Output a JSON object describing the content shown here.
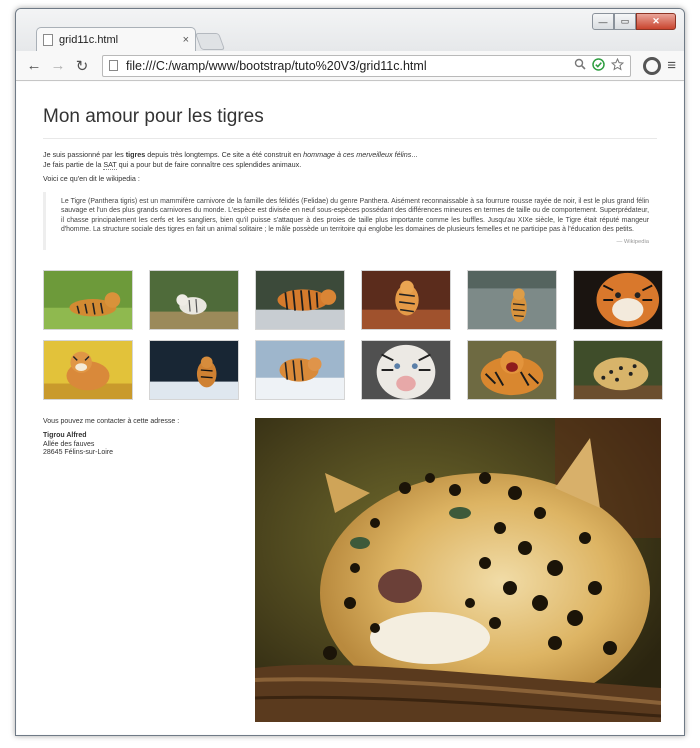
{
  "browser": {
    "tab_title": "grid11c.html",
    "tab_close": "×",
    "url": "file:///C:/wamp/www/bootstrap/tuto%20V3/grid11c.html",
    "nav": {
      "back": "←",
      "forward": "→",
      "reload": "↻"
    },
    "window_controls": {
      "minimize": "—",
      "maximize": "▭",
      "close": "✕"
    },
    "menu_icon": "≡"
  },
  "page": {
    "title": "Mon amour pour les tigres",
    "intro": {
      "line1_before": "Je suis passionné par les ",
      "line1_bold": "tigres",
      "line1_middle": " depuis très longtemps. Ce site a été construit en ",
      "line1_italic": "hommage à ces merveilleux félins",
      "line1_end": "...",
      "line2_before": "Je fais partie de la ",
      "line2_abbr": "SAT",
      "line2_end": " qui a pour but de faire connaître ces splendides animaux."
    },
    "wiki_intro": "Voici ce qu'en dit le wikipedia :",
    "quote": "Le Tigre (Panthera tigris) est un mammifère carnivore de la famille des félidés (Felidae) du genre Panthera. Aisément reconnaissable à sa fourrure rousse rayée de noir, il est le plus grand félin sauvage et l'un des plus grands carnivores du monde. L'espèce est divisée en neuf sous-espèces possédant des différences mineures en termes de taille ou de comportement. Superprédateur, il chasse principalement les cerfs et les sangliers, bien qu'il puisse s'attaquer à des proies de taille plus importante comme les buffles. Jusqu'au XIXe siècle, le Tigre était réputé mangeur d'homme. La structure sociale des tigres en fait un animal solitaire ; le mâle possède un territoire qui englobe les domaines de plusieurs femelles et ne participe pas à l'éducation des petits.",
    "quote_source": "— Wikipedia",
    "contact": {
      "intro": "Vous pouvez me contacter à cette adresse :",
      "name": "Tigrou Alfred",
      "street": "Allée des fauves",
      "city": "28645 Félins-sur-Loire"
    }
  }
}
